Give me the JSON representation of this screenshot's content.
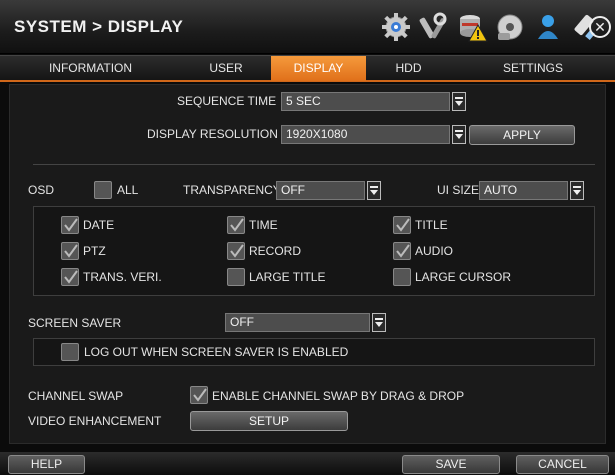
{
  "header": {
    "title": "SYSTEM > DISPLAY"
  },
  "toolbar_icons": [
    "gear-icon",
    "tools-icon",
    "hdd-warning-icon",
    "network-icon",
    "user-icon",
    "usb-icon"
  ],
  "tabs": [
    {
      "label": "INFORMATION",
      "active": false
    },
    {
      "label": "USER",
      "active": false
    },
    {
      "label": "DISPLAY",
      "active": true
    },
    {
      "label": "HDD",
      "active": false
    },
    {
      "label": "SETTINGS",
      "active": false
    }
  ],
  "sequence_time": {
    "label": "SEQUENCE TIME",
    "value": "5 SEC"
  },
  "display_resolution": {
    "label": "DISPLAY RESOLUTION",
    "value": "1920X1080",
    "apply_label": "APPLY"
  },
  "osd": {
    "label": "OSD",
    "all_label": "ALL",
    "all_checked": false,
    "transparency_label": "TRANSPARENCY",
    "transparency_value": "OFF",
    "ui_size_label": "UI SIZE",
    "ui_size_value": "AUTO",
    "items": [
      {
        "label": "DATE",
        "checked": true
      },
      {
        "label": "TIME",
        "checked": true
      },
      {
        "label": "TITLE",
        "checked": true
      },
      {
        "label": "PTZ",
        "checked": true
      },
      {
        "label": "RECORD",
        "checked": true
      },
      {
        "label": "AUDIO",
        "checked": true
      },
      {
        "label": "TRANS. VERI.",
        "checked": true
      },
      {
        "label": "LARGE TITLE",
        "checked": false
      },
      {
        "label": "LARGE CURSOR",
        "checked": false
      }
    ]
  },
  "screen_saver": {
    "label": "SCREEN SAVER",
    "value": "OFF",
    "logout_label": "LOG OUT WHEN SCREEN SAVER IS ENABLED",
    "logout_checked": false
  },
  "channel_swap": {
    "label": "CHANNEL SWAP",
    "option_label": "ENABLE CHANNEL SWAP BY DRAG & DROP",
    "checked": true
  },
  "video_enhancement": {
    "label": "VIDEO ENHANCEMENT",
    "button_label": "SETUP"
  },
  "footer": {
    "help_label": "HELP",
    "save_label": "SAVE",
    "cancel_label": "CANCEL"
  },
  "colors": {
    "accent": "#e8781f",
    "background": "#1a1a1a",
    "field": "#4d4d4d"
  }
}
